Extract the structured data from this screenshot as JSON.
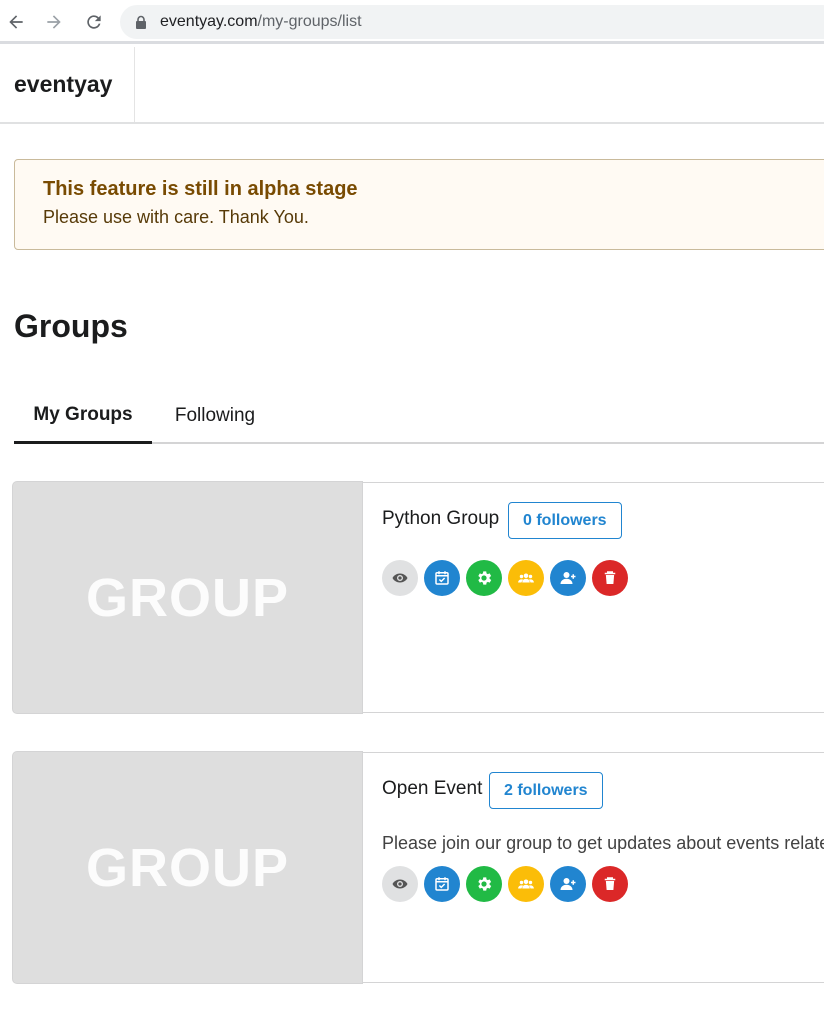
{
  "browser": {
    "url_domain": "eventyay.com",
    "url_path": "/my-groups/list"
  },
  "header": {
    "brand": "eventyay"
  },
  "alert": {
    "title": "This feature is still in alpha stage",
    "message": "Please use with care. Thank You."
  },
  "page": {
    "title": "Groups"
  },
  "tabs": [
    {
      "label": "My Groups",
      "active": true
    },
    {
      "label": "Following",
      "active": false
    }
  ],
  "groups": [
    {
      "image_text": "GROUP",
      "name": "Python Group",
      "followers_label": "0 followers",
      "description": ""
    },
    {
      "image_text": "GROUP",
      "name": "Open Event",
      "followers_label": "2 followers",
      "description": "Please join our group to get updates about events related to"
    }
  ],
  "action_icons": [
    "eye-icon",
    "calendar-check-icon",
    "gear-icon",
    "users-icon",
    "user-plus-icon",
    "trash-icon"
  ],
  "colors": {
    "primary_blue": "#2185d0",
    "green": "#21ba45",
    "yellow": "#fbbd08",
    "red": "#db2828",
    "grey": "#e0e1e2",
    "alert_bg": "#fffaf3",
    "alert_title": "#794b02"
  }
}
